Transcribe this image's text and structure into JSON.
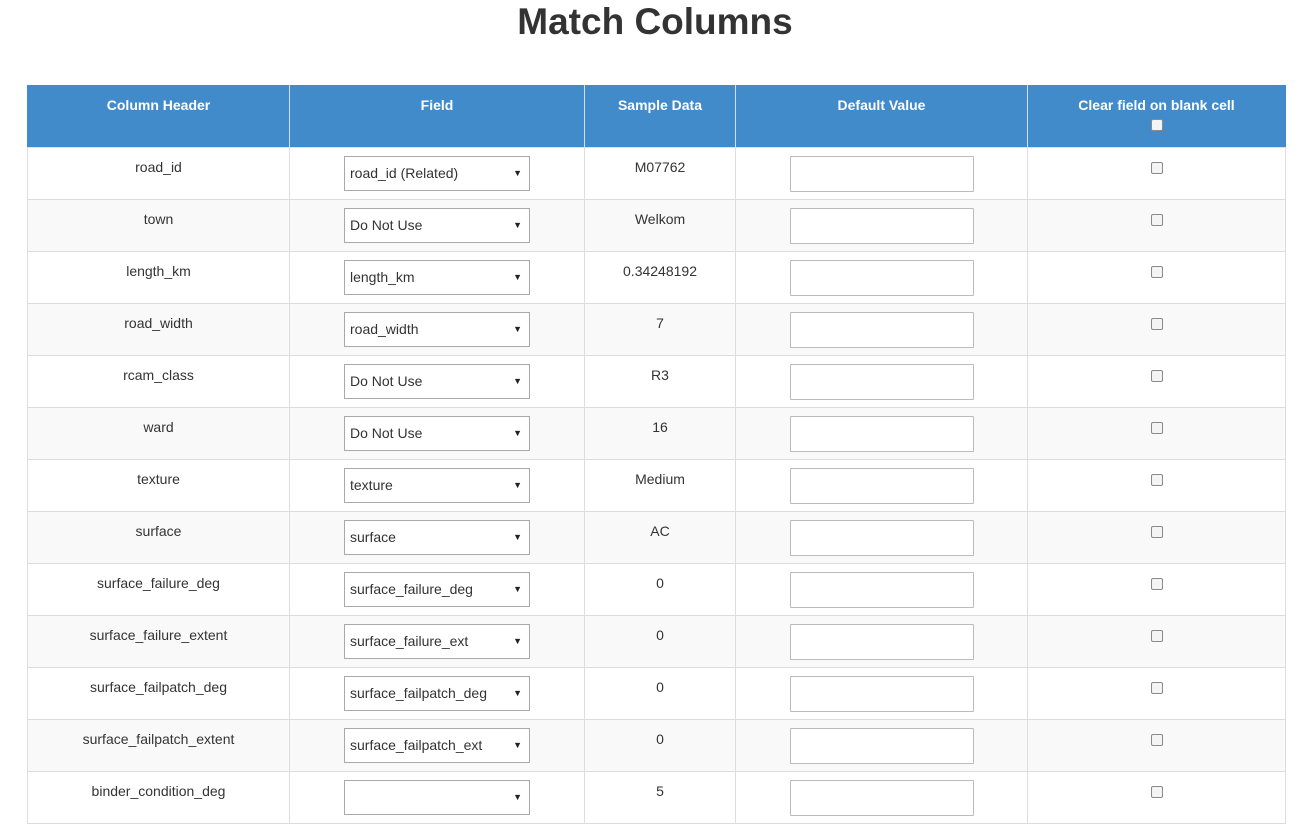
{
  "page": {
    "title": "Match Columns"
  },
  "table": {
    "headers": {
      "column_header": "Column Header",
      "field": "Field",
      "sample_data": "Sample Data",
      "default_value": "Default Value",
      "clear_field": "Clear field on blank cell"
    },
    "header_clear_checked": false,
    "rows": [
      {
        "column": "road_id",
        "field": "road_id (Related)",
        "sample": "M07762",
        "default": "",
        "clear": false
      },
      {
        "column": "town",
        "field": "Do Not Use",
        "sample": "Welkom",
        "default": "",
        "clear": false
      },
      {
        "column": "length_km",
        "field": "length_km",
        "sample": "0.34248192",
        "default": "",
        "clear": false
      },
      {
        "column": "road_width",
        "field": "road_width",
        "sample": "7",
        "default": "",
        "clear": false
      },
      {
        "column": "rcam_class",
        "field": "Do Not Use",
        "sample": "R3",
        "default": "",
        "clear": false
      },
      {
        "column": "ward",
        "field": "Do Not Use",
        "sample": "16",
        "default": "",
        "clear": false
      },
      {
        "column": "texture",
        "field": "texture",
        "sample": "Medium",
        "default": "",
        "clear": false
      },
      {
        "column": "surface",
        "field": "surface",
        "sample": "AC",
        "default": "",
        "clear": false
      },
      {
        "column": "surface_failure_deg",
        "field": "surface_failure_deg",
        "sample": "0",
        "default": "",
        "clear": false
      },
      {
        "column": "surface_failure_extent",
        "field": "surface_failure_ext",
        "sample": "0",
        "default": "",
        "clear": false
      },
      {
        "column": "surface_failpatch_deg",
        "field": "surface_failpatch_deg",
        "sample": "0",
        "default": "",
        "clear": false
      },
      {
        "column": "surface_failpatch_extent",
        "field": "surface_failpatch_ext",
        "sample": "0",
        "default": "",
        "clear": false
      },
      {
        "column": "binder_condition_deg",
        "field": "",
        "sample": "5",
        "default": "",
        "clear": false
      }
    ]
  },
  "icons": {
    "select_arrow": "▼"
  },
  "colors": {
    "header_bg": "#428bca",
    "header_text": "#ffffff",
    "row_alt_bg": "#f9f9f9",
    "border": "#dddddd"
  }
}
